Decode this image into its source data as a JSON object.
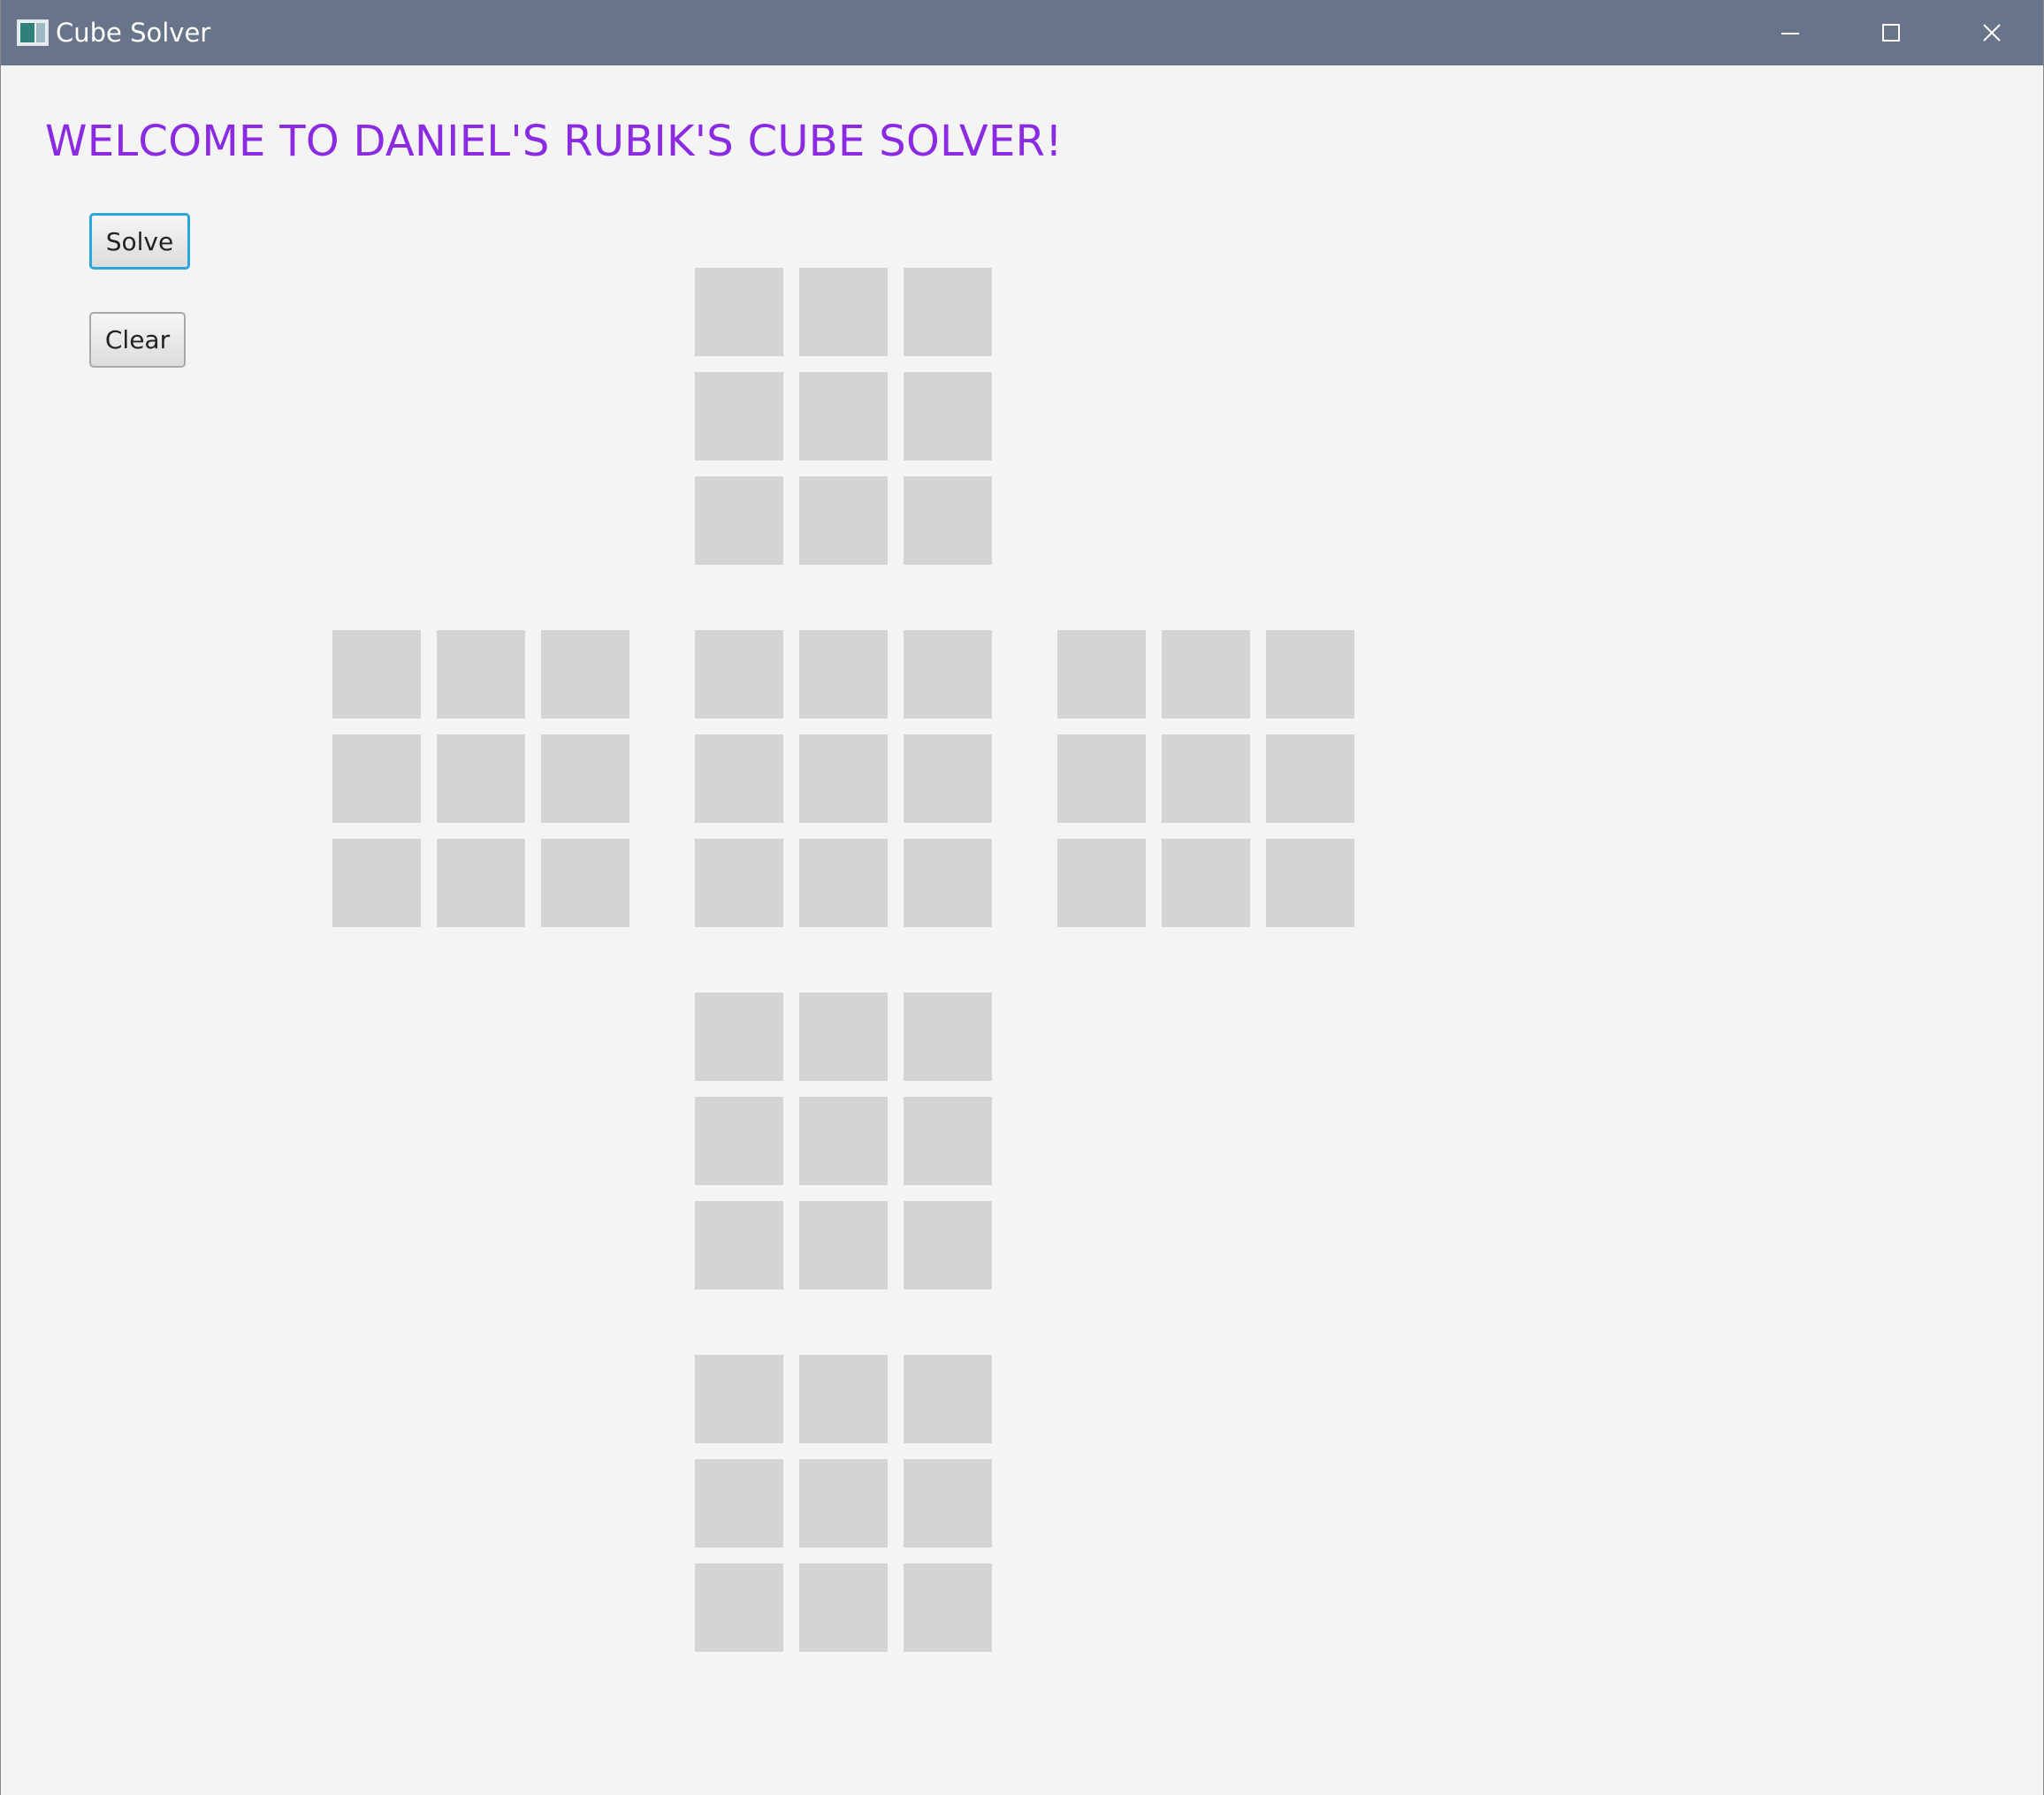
{
  "window": {
    "title": "Cube Solver",
    "icon": "app-window-icon",
    "controls": [
      "minimize-icon",
      "maximize-icon",
      "close-icon"
    ]
  },
  "main": {
    "welcome_text": "WELCOME TO DANIEL'S RUBIK'S CUBE SOLVER!",
    "solve_label": "Solve",
    "clear_label": "Clear"
  },
  "cube": {
    "faces": [
      "up",
      "left",
      "front",
      "right",
      "down",
      "back"
    ],
    "stickers_per_face": 9,
    "sticker_color": "#d4d4d4"
  },
  "colors": {
    "titlebar": "#677489",
    "welcome_text": "#8a2be2",
    "background": "#f4f4f4",
    "focus_ring": "#2aa6dc"
  }
}
